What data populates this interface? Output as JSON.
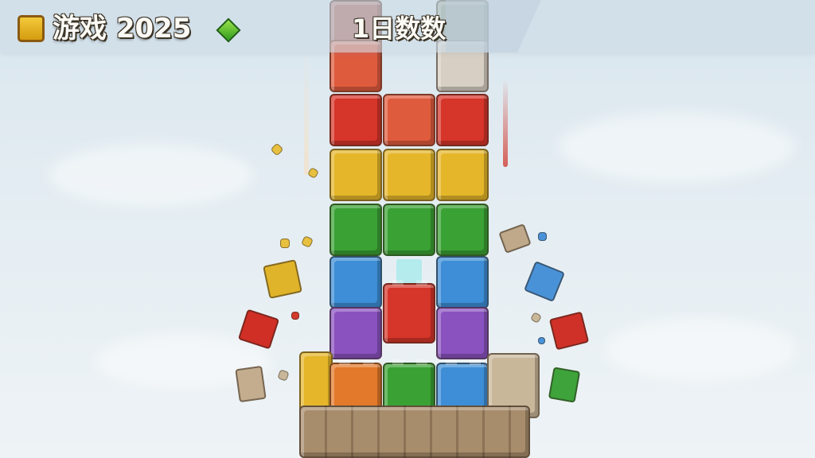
{
  "hud": {
    "title": "游戏 2025",
    "counter": "1日数数",
    "logo_icon": "yellow-block-icon",
    "gem_icon": "green-gem-icon"
  },
  "colors": {
    "red": "#d6352a",
    "yellow": "#e5b62a",
    "green": "#3aa134",
    "blue": "#3d8ed6",
    "purple": "#8a52bf",
    "orange": "#e3792a",
    "stone": "#c9b79a"
  }
}
